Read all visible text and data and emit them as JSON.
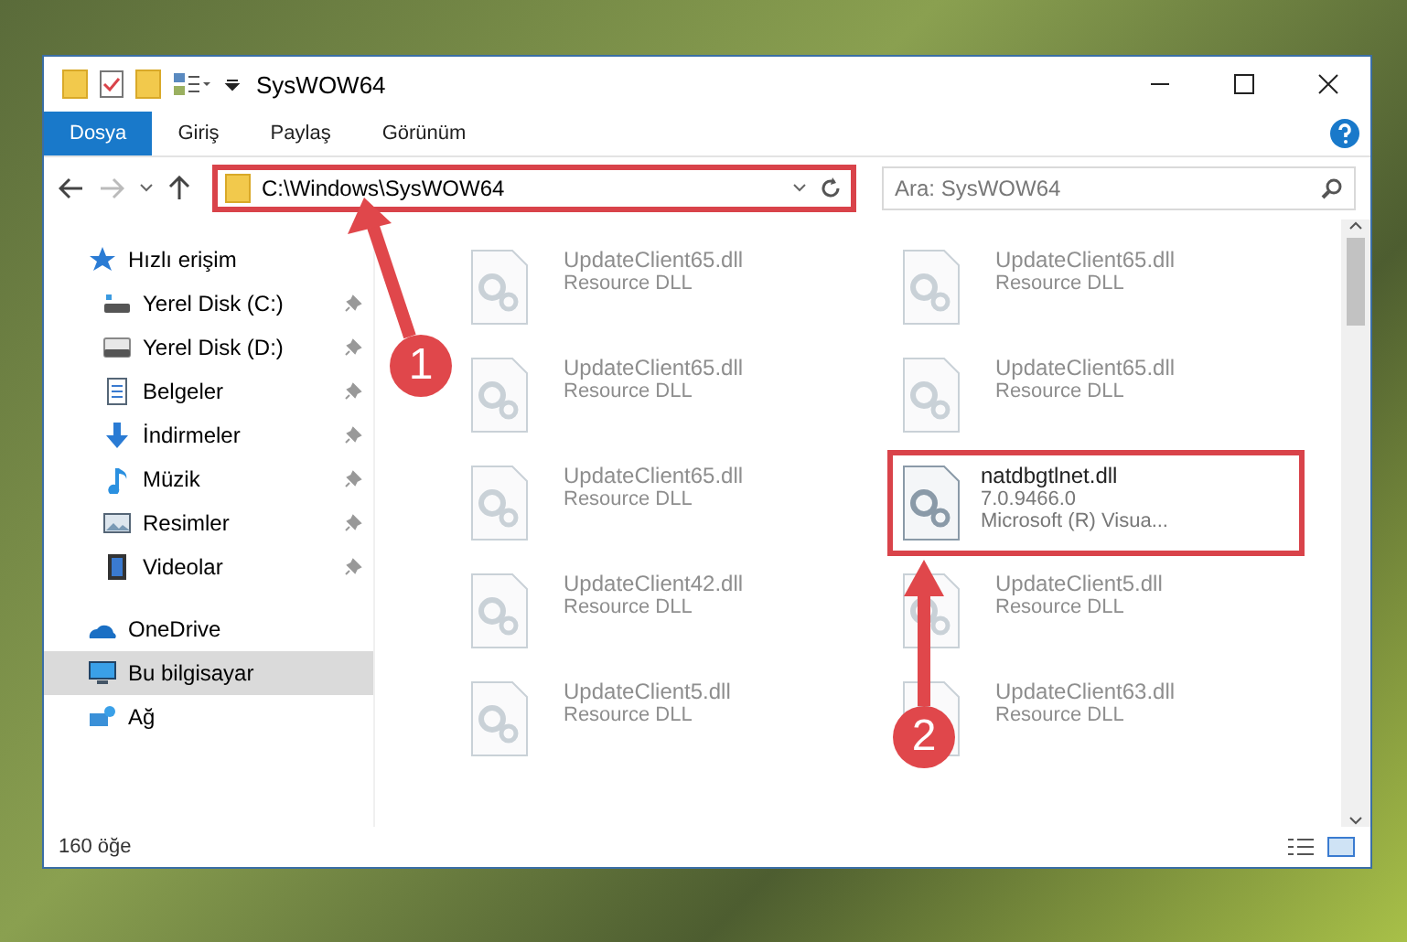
{
  "window": {
    "title": "SysWOW64"
  },
  "ribbon_tabs": [
    {
      "label": "Dosya",
      "selected": true
    },
    {
      "label": "Giriş",
      "selected": false
    },
    {
      "label": "Paylaş",
      "selected": false
    },
    {
      "label": "Görünüm",
      "selected": false
    }
  ],
  "address": {
    "value": "C:\\Windows\\SysWOW64",
    "highlighted": true
  },
  "search": {
    "placeholder": "Ara: SysWOW64"
  },
  "sidebar": {
    "items": [
      {
        "label": "Hızlı erişim",
        "selected": false,
        "children": [
          {
            "label": "Yerel Disk (C:)",
            "pinned": true,
            "selected": false
          },
          {
            "label": "Yerel Disk (D:)",
            "pinned": true,
            "selected": false
          },
          {
            "label": "Belgeler",
            "pinned": true,
            "selected": false
          },
          {
            "label": "İndirmeler",
            "pinned": true,
            "selected": false
          },
          {
            "label": "Müzik",
            "pinned": true,
            "selected": false
          },
          {
            "label": "Resimler",
            "pinned": true,
            "selected": false
          },
          {
            "label": "Videolar",
            "pinned": true,
            "selected": false
          }
        ]
      },
      {
        "label": "OneDrive",
        "selected": false
      },
      {
        "label": "Bu bilgisayar",
        "selected": true
      },
      {
        "label": "Ağ",
        "selected": false
      }
    ]
  },
  "files": [
    {
      "kind": "faded",
      "name": "UpdateClient65.dll",
      "lines": [
        "Resource DLL"
      ]
    },
    {
      "kind": "faded",
      "name": "UpdateClient65.dll",
      "lines": [
        "Resource DLL"
      ]
    },
    {
      "kind": "faded",
      "name": "UpdateClient65.dll",
      "lines": [
        "Resource DLL"
      ]
    },
    {
      "kind": "faded",
      "name": "UpdateClient65.dll",
      "lines": [
        "Resource DLL"
      ]
    },
    {
      "kind": "faded",
      "name": "UpdateClient65.dll",
      "lines": [
        "Resource DLL"
      ]
    },
    {
      "kind": "focus",
      "name": "natdbgtlnet.dll",
      "lines": [
        "7.0.9466.0",
        "Microsoft (R) Visua..."
      ]
    },
    {
      "kind": "faded",
      "name": "UpdateClient42.dll",
      "lines": [
        "Resource DLL"
      ]
    },
    {
      "kind": "faded",
      "name": "UpdateClient5.dll",
      "lines": [
        "Resource DLL"
      ]
    },
    {
      "kind": "faded",
      "name": "UpdateClient5.dll",
      "lines": [
        "Resource DLL"
      ]
    },
    {
      "kind": "faded",
      "name": "UpdateClient63.dll",
      "lines": [
        "Resource DLL"
      ]
    }
  ],
  "status_bar": {
    "count": "160 öğe"
  },
  "annotations": [
    {
      "label": "1"
    },
    {
      "label": "2"
    }
  ]
}
